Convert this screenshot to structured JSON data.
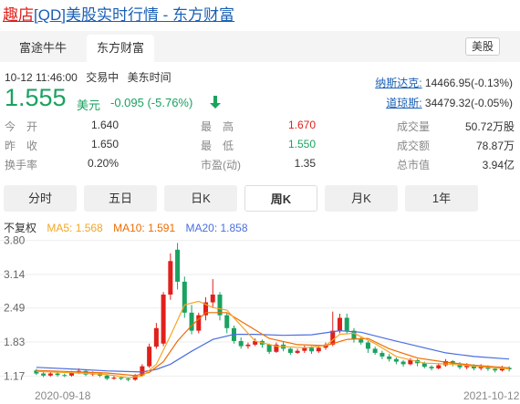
{
  "title": {
    "highlight": "趣店",
    "rest": "[QD]美股实时行情 - 东方财富"
  },
  "tabs": [
    {
      "label": "富途牛牛"
    },
    {
      "label": "东方财富"
    }
  ],
  "market_tag": "美股",
  "meta": {
    "datetime": "10-12 11:46:00",
    "status": "交易中",
    "tz": "美东时间"
  },
  "quote": {
    "price": "1.555",
    "currency": "美元",
    "change": "-0.095 (-5.76%)"
  },
  "indices": [
    {
      "name": "纳斯达克:",
      "value": "14466.95(-0.13%)"
    },
    {
      "name": "道琼斯:",
      "value": "34479.32(-0.05%)"
    }
  ],
  "stats": {
    "open_label": "今开",
    "open": "1.640",
    "high_label": "最高",
    "high": "1.670",
    "volume_label": "成交量",
    "volume": "50.72万股",
    "prev_label": "昨收",
    "prev": "1.650",
    "low_label": "最低",
    "low": "1.550",
    "amount_label": "成交额",
    "amount": "78.87万",
    "turnover_label": "换手率",
    "turnover": "0.20%",
    "pe_label": "市盈(动)",
    "pe": "1.35",
    "mcap_label": "总市值",
    "mcap": "3.94亿"
  },
  "periods": [
    {
      "label": "分时"
    },
    {
      "label": "五日"
    },
    {
      "label": "日K"
    },
    {
      "label": "周K"
    },
    {
      "label": "月K"
    },
    {
      "label": "1年"
    }
  ],
  "ma_legend": {
    "adj": "不复权",
    "ma5": "MA5: 1.568",
    "ma10": "MA10: 1.591",
    "ma20": "MA20: 1.858"
  },
  "colors": {
    "up": "#e0201b",
    "down": "#1aa260",
    "ma5": "#f5a623",
    "ma10": "#ef6c00",
    "ma20": "#4a6ee0"
  },
  "chart_data": {
    "type": "candlestick",
    "y_ticks": [
      "3.80",
      "3.14",
      "2.49",
      "1.83",
      "1.17"
    ],
    "ylim": [
      1.0,
      3.9
    ],
    "x_labels": [
      "2020-09-18",
      "2021-10-12"
    ],
    "candles": [
      [
        1.28,
        1.22,
        1.31,
        1.19
      ],
      [
        1.22,
        1.18,
        1.25,
        1.15
      ],
      [
        1.18,
        1.22,
        1.26,
        1.16
      ],
      [
        1.22,
        1.19,
        1.24,
        1.16
      ],
      [
        1.19,
        1.18,
        1.22,
        1.15
      ],
      [
        1.18,
        1.24,
        1.27,
        1.16
      ],
      [
        1.24,
        1.27,
        1.32,
        1.21
      ],
      [
        1.27,
        1.2,
        1.29,
        1.17
      ],
      [
        1.2,
        1.22,
        1.26,
        1.17
      ],
      [
        1.22,
        1.18,
        1.24,
        1.15
      ],
      [
        1.18,
        1.12,
        1.2,
        1.09
      ],
      [
        1.12,
        1.14,
        1.17,
        1.1
      ],
      [
        1.14,
        1.12,
        1.16,
        1.09
      ],
      [
        1.12,
        1.1,
        1.14,
        1.07
      ],
      [
        1.1,
        1.18,
        1.21,
        1.08
      ],
      [
        1.18,
        1.36,
        1.4,
        1.16
      ],
      [
        1.36,
        1.74,
        1.8,
        1.33
      ],
      [
        1.74,
        2.1,
        2.2,
        1.7
      ],
      [
        1.8,
        2.75,
        2.8,
        1.75
      ],
      [
        2.75,
        3.4,
        3.55,
        2.65
      ],
      [
        3.62,
        3.0,
        3.75,
        2.85
      ],
      [
        3.0,
        2.4,
        3.1,
        2.3
      ],
      [
        2.4,
        2.05,
        2.55,
        1.98
      ],
      [
        2.05,
        2.35,
        2.4,
        2.0
      ],
      [
        2.35,
        2.6,
        2.7,
        2.25
      ],
      [
        2.6,
        2.75,
        3.05,
        2.5
      ],
      [
        2.75,
        2.35,
        2.8,
        2.25
      ],
      [
        2.35,
        2.1,
        2.4,
        2.0
      ],
      [
        2.1,
        1.85,
        2.15,
        1.8
      ],
      [
        1.85,
        1.75,
        1.92,
        1.7
      ],
      [
        1.75,
        1.78,
        1.82,
        1.7
      ],
      [
        1.78,
        1.85,
        1.9,
        1.75
      ],
      [
        1.85,
        1.78,
        1.88,
        1.72
      ],
      [
        1.78,
        1.64,
        1.8,
        1.6
      ],
      [
        1.64,
        1.78,
        1.82,
        1.62
      ],
      [
        1.78,
        1.7,
        1.85,
        1.65
      ],
      [
        1.7,
        1.62,
        1.72,
        1.58
      ],
      [
        1.62,
        1.66,
        1.7,
        1.6
      ],
      [
        1.66,
        1.72,
        1.76,
        1.62
      ],
      [
        1.72,
        1.65,
        1.75,
        1.6
      ],
      [
        1.65,
        1.72,
        1.76,
        1.62
      ],
      [
        1.72,
        1.78,
        1.82,
        1.68
      ],
      [
        1.78,
        2.05,
        2.42,
        1.75
      ],
      [
        2.05,
        2.3,
        2.38,
        2.0
      ],
      [
        2.3,
        2.05,
        2.38,
        2.0
      ],
      [
        2.05,
        1.88,
        2.1,
        1.82
      ],
      [
        1.88,
        1.82,
        1.92,
        1.78
      ],
      [
        1.82,
        1.7,
        1.85,
        1.62
      ],
      [
        1.7,
        1.62,
        1.74,
        1.58
      ],
      [
        1.62,
        1.55,
        1.66,
        1.5
      ],
      [
        1.55,
        1.5,
        1.6,
        1.45
      ],
      [
        1.5,
        1.45,
        1.53,
        1.4
      ],
      [
        1.45,
        1.4,
        1.48,
        1.35
      ],
      [
        1.4,
        1.48,
        1.52,
        1.38
      ],
      [
        1.48,
        1.42,
        1.5,
        1.36
      ],
      [
        1.42,
        1.35,
        1.45,
        1.32
      ],
      [
        1.35,
        1.32,
        1.38,
        1.28
      ],
      [
        1.32,
        1.38,
        1.42,
        1.3
      ],
      [
        1.38,
        1.46,
        1.5,
        1.35
      ],
      [
        1.46,
        1.4,
        1.48,
        1.36
      ],
      [
        1.4,
        1.34,
        1.44,
        1.3
      ],
      [
        1.34,
        1.38,
        1.42,
        1.3
      ],
      [
        1.38,
        1.32,
        1.4,
        1.28
      ],
      [
        1.32,
        1.36,
        1.4,
        1.28
      ],
      [
        1.36,
        1.31,
        1.38,
        1.27
      ],
      [
        1.31,
        1.28,
        1.34,
        1.24
      ],
      [
        1.28,
        1.33,
        1.37,
        1.26
      ],
      [
        1.33,
        1.3,
        1.36,
        1.26
      ]
    ],
    "ma5": [
      [
        0,
        1.26
      ],
      [
        6,
        1.23
      ],
      [
        10,
        1.2
      ],
      [
        13,
        1.14
      ],
      [
        15,
        1.17
      ],
      [
        17,
        1.4
      ],
      [
        19,
        1.95
      ],
      [
        21,
        2.55
      ],
      [
        23,
        2.62
      ],
      [
        25,
        2.5
      ],
      [
        27,
        2.45
      ],
      [
        29,
        2.15
      ],
      [
        31,
        1.85
      ],
      [
        34,
        1.75
      ],
      [
        38,
        1.72
      ],
      [
        41,
        1.76
      ],
      [
        43,
        1.98
      ],
      [
        45,
        2.0
      ],
      [
        48,
        1.8
      ],
      [
        51,
        1.55
      ],
      [
        55,
        1.42
      ],
      [
        59,
        1.4
      ],
      [
        63,
        1.35
      ],
      [
        67,
        1.31
      ]
    ],
    "ma10": [
      [
        0,
        1.28
      ],
      [
        6,
        1.25
      ],
      [
        10,
        1.23
      ],
      [
        14,
        1.18
      ],
      [
        16,
        1.24
      ],
      [
        18,
        1.45
      ],
      [
        20,
        1.85
      ],
      [
        22,
        2.15
      ],
      [
        24,
        2.4
      ],
      [
        27,
        2.4
      ],
      [
        30,
        2.15
      ],
      [
        33,
        1.9
      ],
      [
        37,
        1.78
      ],
      [
        41,
        1.76
      ],
      [
        44,
        1.88
      ],
      [
        47,
        1.9
      ],
      [
        50,
        1.7
      ],
      [
        54,
        1.52
      ],
      [
        58,
        1.44
      ],
      [
        62,
        1.38
      ],
      [
        67,
        1.33
      ]
    ],
    "ma20": [
      [
        0,
        1.34
      ],
      [
        6,
        1.3
      ],
      [
        10,
        1.27
      ],
      [
        15,
        1.25
      ],
      [
        17,
        1.3
      ],
      [
        19,
        1.4
      ],
      [
        22,
        1.65
      ],
      [
        25,
        1.88
      ],
      [
        28,
        1.98
      ],
      [
        31,
        1.98
      ],
      [
        35,
        1.96
      ],
      [
        39,
        1.97
      ],
      [
        43,
        2.05
      ],
      [
        46,
        2.02
      ],
      [
        50,
        1.88
      ],
      [
        54,
        1.75
      ],
      [
        58,
        1.62
      ],
      [
        62,
        1.55
      ],
      [
        67,
        1.5
      ]
    ]
  }
}
